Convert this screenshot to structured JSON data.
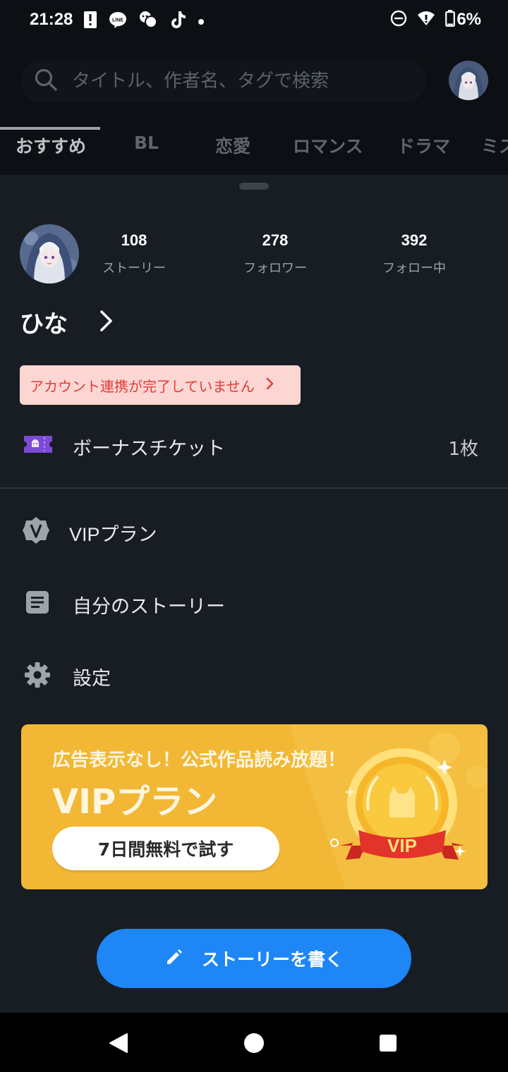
{
  "status_bar": {
    "time": "21:28",
    "battery": "6%",
    "icons_left": [
      "alert-icon",
      "line-icon",
      "chat-icon",
      "tiktok-icon",
      "dot-icon"
    ],
    "icons_right": [
      "dnd-icon",
      "wifi-icon",
      "battery-icon"
    ]
  },
  "search": {
    "placeholder": "タイトル、作者名、タグで検索"
  },
  "tabs": [
    "おすすめ",
    "BL",
    "恋愛",
    "ロマンス",
    "ドラマ",
    "ミス"
  ],
  "profile": {
    "stats": [
      {
        "value": "108",
        "label": "ストーリー"
      },
      {
        "value": "278",
        "label": "フォロワー"
      },
      {
        "value": "392",
        "label": "フォロー中"
      }
    ],
    "username": "ひな"
  },
  "alert": {
    "text": "アカウント連携が完了していません"
  },
  "menu": {
    "bonus_ticket": {
      "label": "ボーナスチケット",
      "value": "1枚"
    },
    "vip_plan": {
      "label": "VIPプラン"
    },
    "my_stories": {
      "label": "自分のストーリー"
    },
    "settings": {
      "label": "設定"
    }
  },
  "vip_banner": {
    "subtitle": "広告表示なし！公式作品読み放題！",
    "title": "VIPプラン",
    "cta": "7日間無料で試す",
    "medal_text": "VIP"
  },
  "write_button": {
    "label": "ストーリーを書く"
  },
  "colors": {
    "accent_blue": "#1e86f5",
    "vip_gold": "#f2b734",
    "alert_bg": "#fcd6d3",
    "alert_text": "#e53b34",
    "sheet_bg": "#181d24"
  }
}
